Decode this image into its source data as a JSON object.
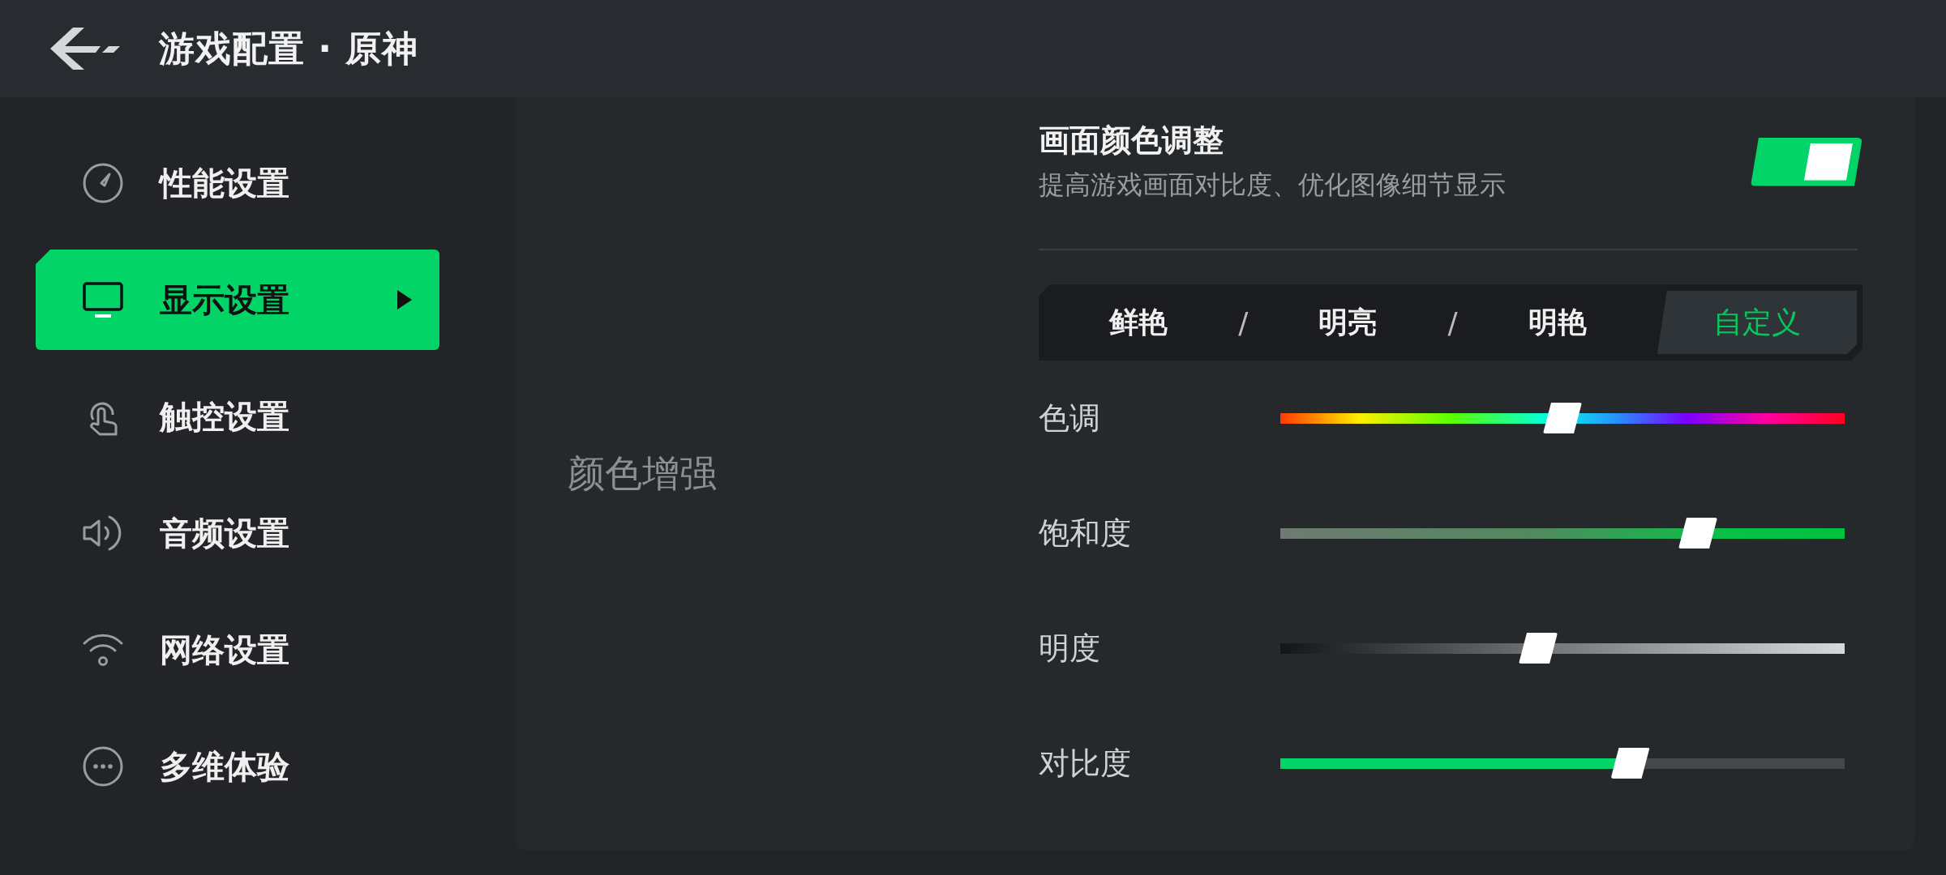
{
  "header": {
    "title": "游戏配置 · 原神"
  },
  "sidebar": {
    "items": [
      {
        "label": "性能设置",
        "selected": false
      },
      {
        "label": "显示设置",
        "selected": true
      },
      {
        "label": "触控设置",
        "selected": false
      },
      {
        "label": "音频设置",
        "selected": false
      },
      {
        "label": "网络设置",
        "selected": false
      },
      {
        "label": "多维体验",
        "selected": false
      }
    ]
  },
  "section": {
    "label": "颜色增强",
    "toggle": {
      "title": "画面颜色调整",
      "description": "提高游戏画面对比度、优化图像细节显示",
      "on": true
    },
    "modes": [
      {
        "label": "鲜艳",
        "selected": false
      },
      {
        "label": "明亮",
        "selected": false
      },
      {
        "label": "明艳",
        "selected": false
      },
      {
        "label": "自定义",
        "selected": true
      }
    ],
    "separators": [
      "/",
      "/"
    ],
    "sliders": [
      {
        "label": "色调",
        "kind": "hue",
        "level": 0.5
      },
      {
        "label": "饱和度",
        "kind": "saturation",
        "level": 0.74
      },
      {
        "label": "明度",
        "kind": "brightness",
        "level": 0.457
      },
      {
        "label": "对比度",
        "kind": "contrast",
        "level": 0.62
      }
    ]
  }
}
